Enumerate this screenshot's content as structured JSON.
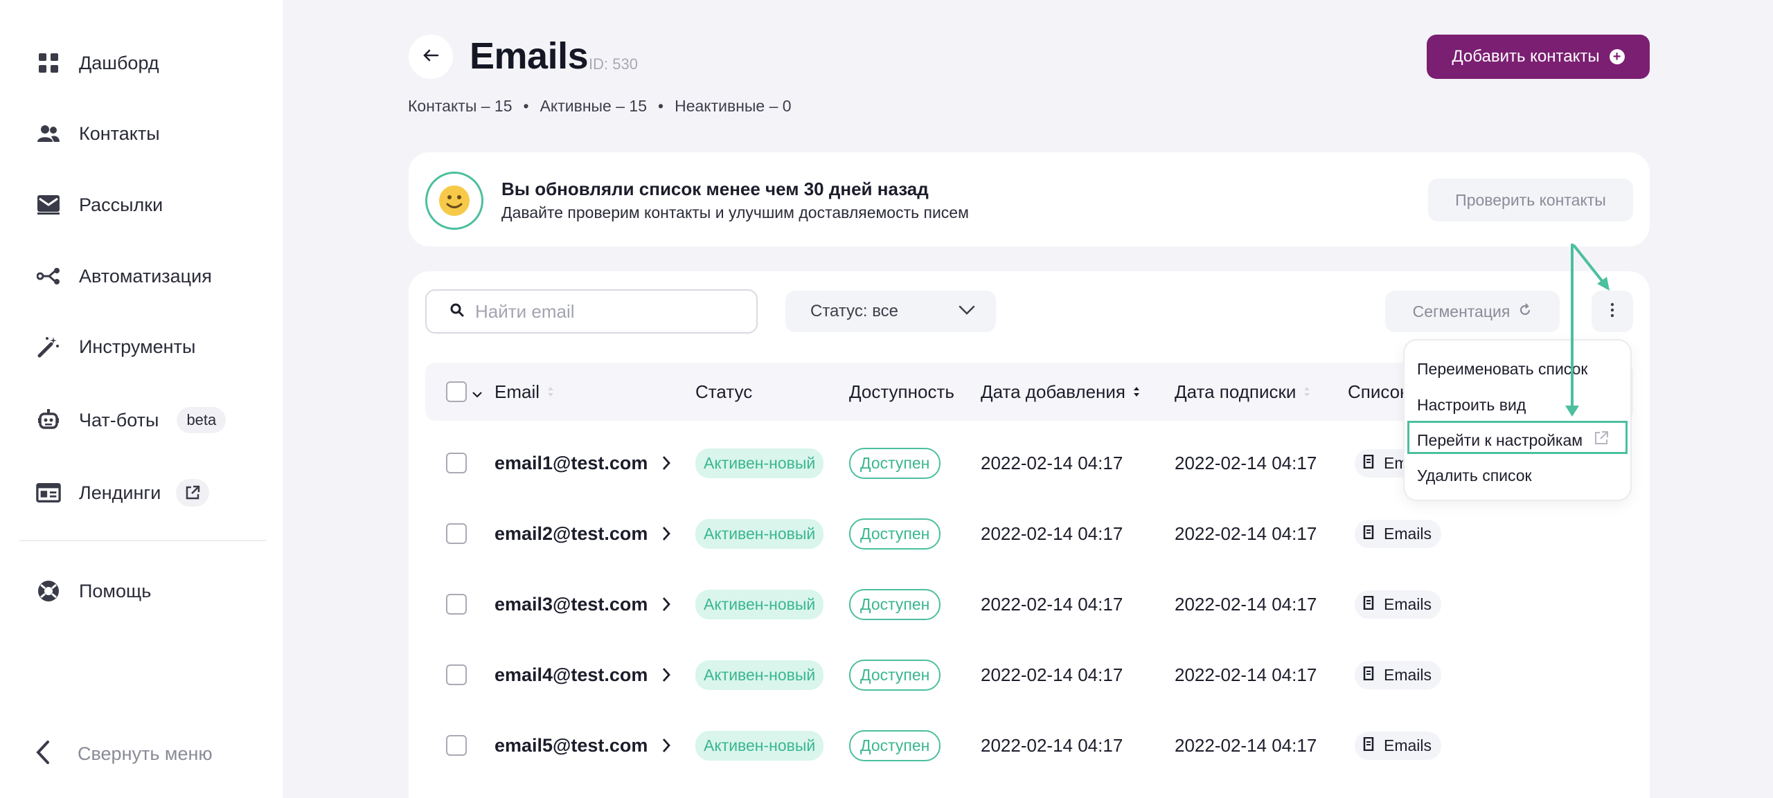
{
  "sidebar": {
    "items": [
      {
        "label": "Дашборд",
        "icon": "dashboard-icon"
      },
      {
        "label": "Контакты",
        "icon": "contacts-icon"
      },
      {
        "label": "Рассылки",
        "icon": "mail-icon"
      },
      {
        "label": "Автоматизация",
        "icon": "automation-icon"
      },
      {
        "label": "Инструменты",
        "icon": "magic-wand-icon"
      },
      {
        "label": "Чат-боты",
        "icon": "robot-icon",
        "badge": "beta"
      },
      {
        "label": "Лендинги",
        "icon": "landing-icon"
      },
      {
        "label": "Помощь",
        "icon": "help-icon"
      }
    ],
    "collapse_label": "Свернуть меню"
  },
  "header": {
    "title": "Emails",
    "id_label": "ID: 530",
    "stats": [
      "Контакты – 15",
      "Активные – 15",
      "Неактивные – 0"
    ],
    "add_button": "Добавить контакты"
  },
  "notice": {
    "title": "Вы обновляли список менее чем 30 дней назад",
    "subtitle": "Давайте проверим контакты и улучшим доставляемость писем",
    "button": "Проверить контакты"
  },
  "toolbar": {
    "search_placeholder": "Найти email",
    "status_filter": "Статус: все",
    "segmentation": "Сегментация"
  },
  "table": {
    "columns": [
      "Email",
      "Статус",
      "Доступность",
      "Дата добавления",
      "Дата подписки",
      "Список"
    ],
    "rows": [
      {
        "email": "email1@test.com",
        "status": "Активен-новый",
        "availability": "Доступен",
        "added": "2022-02-14 04:17",
        "subscribed": "2022-02-14 04:17",
        "list": "Em"
      },
      {
        "email": "email2@test.com",
        "status": "Активен-новый",
        "availability": "Доступен",
        "added": "2022-02-14 04:17",
        "subscribed": "2022-02-14 04:17",
        "list": "Emails"
      },
      {
        "email": "email3@test.com",
        "status": "Активен-новый",
        "availability": "Доступен",
        "added": "2022-02-14 04:17",
        "subscribed": "2022-02-14 04:17",
        "list": "Emails"
      },
      {
        "email": "email4@test.com",
        "status": "Активен-новый",
        "availability": "Доступен",
        "added": "2022-02-14 04:17",
        "subscribed": "2022-02-14 04:17",
        "list": "Emails"
      },
      {
        "email": "email5@test.com",
        "status": "Активен-новый",
        "availability": "Доступен",
        "added": "2022-02-14 04:17",
        "subscribed": "2022-02-14 04:17",
        "list": "Emails"
      }
    ]
  },
  "menu": {
    "items": [
      "Переименовать список",
      "Настроить вид",
      "Перейти к настройкам",
      "Удалить список"
    ],
    "highlighted": "Перейти к настройкам"
  },
  "colors": {
    "accent": "#7b1f72",
    "green": "#4bbf9e",
    "background": "#f4f4f8"
  }
}
